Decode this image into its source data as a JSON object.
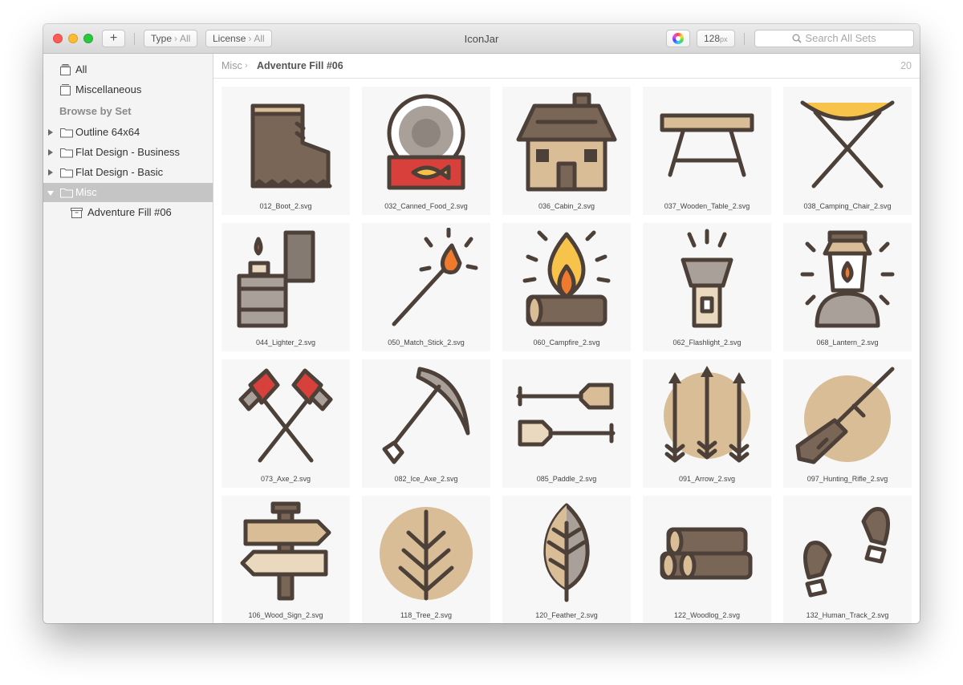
{
  "window": {
    "title": "IconJar"
  },
  "toolbar": {
    "add_label": "+",
    "type_filter": {
      "label": "Type",
      "value": "All"
    },
    "license_filter": {
      "label": "License",
      "value": "All"
    },
    "size_value": "128",
    "size_unit": "px",
    "search_placeholder": "Search All Sets"
  },
  "sidebar": {
    "all_label": "All",
    "misc_label": "Miscellaneous",
    "browse_heading": "Browse by Set",
    "sets": [
      {
        "label": "Outline 64x64"
      },
      {
        "label": "Flat Design - Business"
      },
      {
        "label": "Flat Design - Basic"
      },
      {
        "label": "Misc"
      }
    ],
    "subset_label": "Adventure Fill #06"
  },
  "breadcrumb": {
    "parent": "Misc",
    "separator": "›",
    "current": "Adventure Fill #06",
    "count": "20"
  },
  "icons": [
    {
      "name": "012_Boot_2.svg",
      "icon": "boot-icon"
    },
    {
      "name": "032_Canned_Food_2.svg",
      "icon": "canned-food-icon"
    },
    {
      "name": "036_Cabin_2.svg",
      "icon": "cabin-icon"
    },
    {
      "name": "037_Wooden_Table_2.svg",
      "icon": "wooden-table-icon"
    },
    {
      "name": "038_Camping_Chair_2.svg",
      "icon": "camping-chair-icon"
    },
    {
      "name": "044_Lighter_2.svg",
      "icon": "lighter-icon"
    },
    {
      "name": "050_Match_Stick_2.svg",
      "icon": "match-stick-icon"
    },
    {
      "name": "060_Campfire_2.svg",
      "icon": "campfire-icon"
    },
    {
      "name": "062_Flashlight_2.svg",
      "icon": "flashlight-icon"
    },
    {
      "name": "068_Lantern_2.svg",
      "icon": "lantern-icon"
    },
    {
      "name": "073_Axe_2.svg",
      "icon": "axe-icon"
    },
    {
      "name": "082_Ice_Axe_2.svg",
      "icon": "ice-axe-icon"
    },
    {
      "name": "085_Paddle_2.svg",
      "icon": "paddle-icon"
    },
    {
      "name": "091_Arrow_2.svg",
      "icon": "arrow-icon"
    },
    {
      "name": "097_Hunting_Rifle_2.svg",
      "icon": "hunting-rifle-icon"
    },
    {
      "name": "106_Wood_Sign_2.svg",
      "icon": "wood-sign-icon"
    },
    {
      "name": "118_Tree_2.svg",
      "icon": "tree-icon"
    },
    {
      "name": "120_Feather_2.svg",
      "icon": "feather-icon"
    },
    {
      "name": "122_Woodlog_2.svg",
      "icon": "woodlog-icon"
    },
    {
      "name": "132_Human_Track_2.svg",
      "icon": "human-track-icon"
    }
  ],
  "colors": {
    "outline": "#4d4038",
    "brown": "#7a6656",
    "tan": "#d8bd96",
    "light_tan": "#ead9bf",
    "grey": "#a9a09a",
    "red": "#d8403b",
    "yellow": "#f8c34a",
    "orange": "#ef7a2e"
  }
}
